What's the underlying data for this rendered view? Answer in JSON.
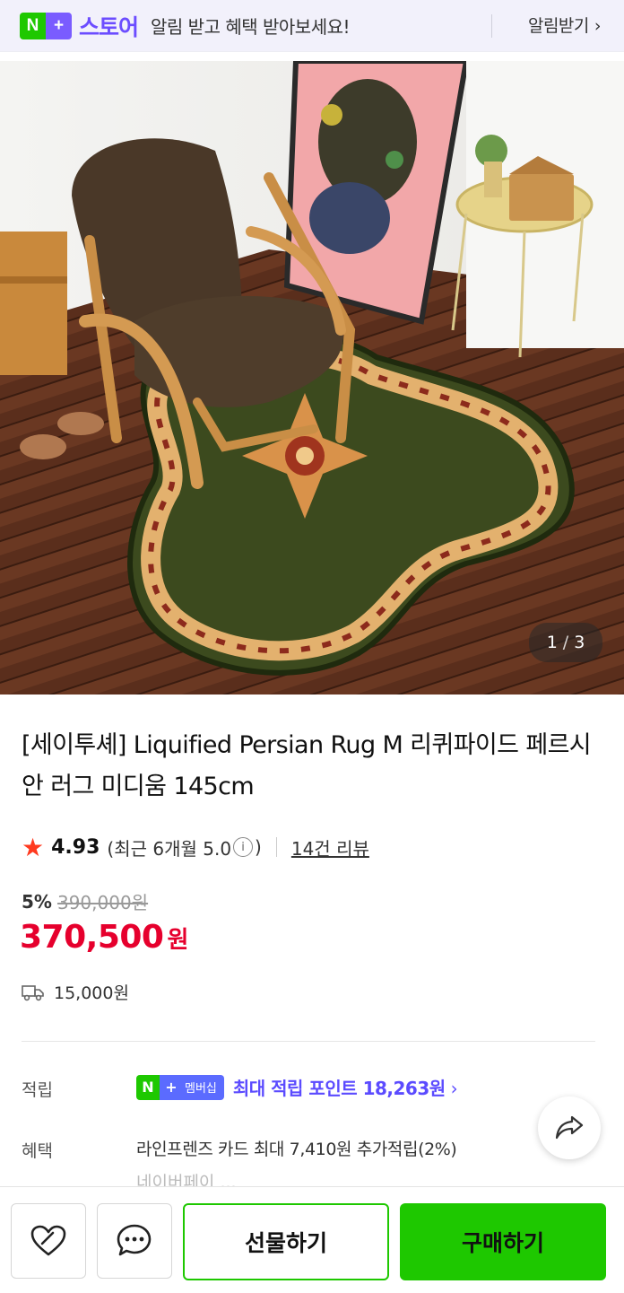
{
  "topbar": {
    "logo_n": "N",
    "logo_plus": "+",
    "store_name": "스토어",
    "promo_text": "알림 받고 혜택 받아보세요!",
    "alarm_label": "알림받기",
    "alarm_chevron": "›"
  },
  "gallery": {
    "current": "1",
    "separator": "/",
    "total": "3"
  },
  "product": {
    "title": "[세이투셰] Liquified Persian Rug M 리퀴파이드 페르시안 러그 미디움 145cm",
    "rating_star": "★",
    "rating": "4.93",
    "recent_rating_prefix": "(최근 6개월 5.0",
    "recent_rating_suffix": ")",
    "info_icon": "i",
    "review_count": "14건 리뷰",
    "discount_percent": "5%",
    "original_price": "390,000원",
    "sale_price": "370,500",
    "currency": "원",
    "shipping_fee": "15,000원"
  },
  "details": {
    "earn_label": "적립",
    "badge_n": "N",
    "badge_plus": "+",
    "badge_member": "멤버십",
    "earn_text": "최대 적립 포인트 18,263원",
    "earn_chevron": "›",
    "benefit_label": "혜택",
    "benefit_text": "라인프렌즈 카드 최대 7,410원 추가적립(2%)",
    "benefit_text_2": "네이버페이 ...",
    "benefit_more": "›"
  },
  "bottom_bar": {
    "gift_label": "선물하기",
    "buy_label": "구매하기"
  },
  "colors": {
    "brand_green": "#1ec800",
    "plus_purple": "#7a5cff",
    "price_red": "#e6002d",
    "membership_blue": "#5b4bff"
  }
}
